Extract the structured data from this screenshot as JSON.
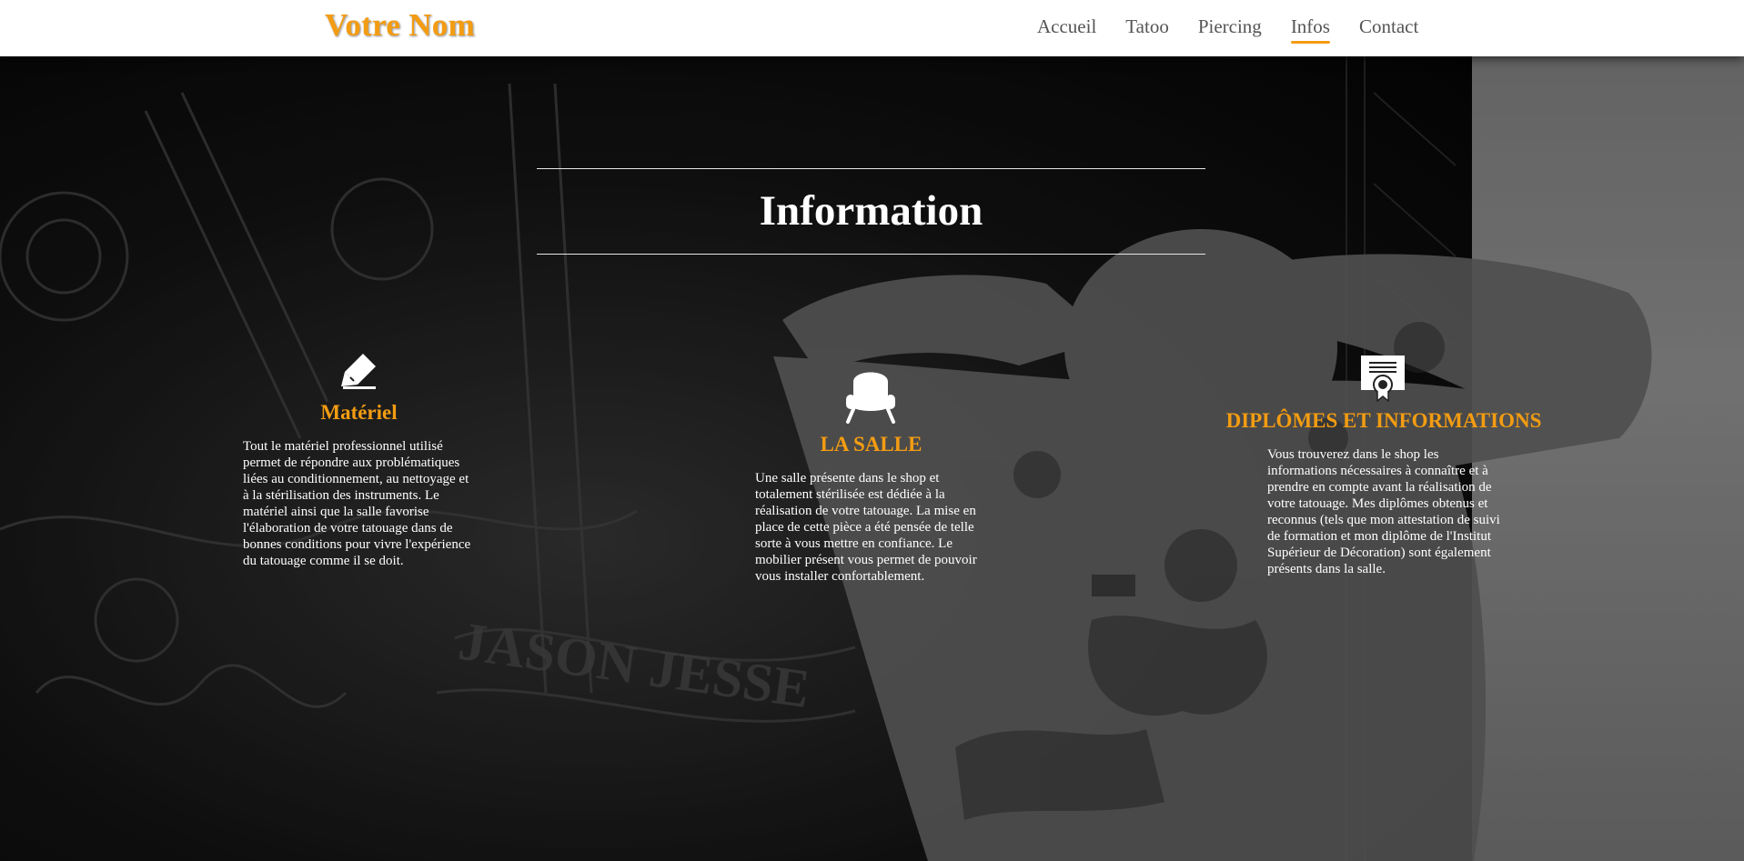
{
  "header": {
    "brand": "Votre Nom",
    "nav": [
      {
        "label": "Accueil",
        "active": false
      },
      {
        "label": "Tatoo",
        "active": false
      },
      {
        "label": "Piercing",
        "active": false
      },
      {
        "label": "Infos",
        "active": true
      },
      {
        "label": "Contact",
        "active": false
      }
    ]
  },
  "main": {
    "title": "Information",
    "columns": [
      {
        "icon": "highlighter-pen-icon",
        "heading": "Matériel",
        "text": "Tout le matériel professionnel utilisé permet de répondre aux problématiques liées au conditionnement, au nettoyage et à la stérilisation des instruments. Le matériel ainsi que la salle favorise l'élaboration de votre tatouage dans de bonnes conditions pour vivre l'expérience du tatouage comme il se doit."
      },
      {
        "icon": "armchair-icon",
        "heading": "LA SALLE",
        "text": "Une salle présente dans le shop et totalement stérilisée est dédiée à la réalisation de votre tatouage. La mise en place de cette pièce a été pensée de telle sorte à vous mettre en confiance. Le mobilier présent vous permet de pouvoir vous installer confortablement."
      },
      {
        "icon": "certificate-icon",
        "heading": "DIPLÔMES ET INFORMATIONS",
        "text": "Vous trouverez dans le shop les informations nécessaires à connaître et à prendre en compte avant la réalisation de votre tatouage. Mes diplômes obtenus et reconnus (tels que mon attestation de suivi de formation et mon diplôme de l'Institut Supérieur de Décoration) sont également présents dans la salle."
      }
    ]
  },
  "colors": {
    "accent": "#f39c12",
    "header_bg": "#ffffff",
    "nav_text": "#555555",
    "body_text": "#ffffff"
  }
}
